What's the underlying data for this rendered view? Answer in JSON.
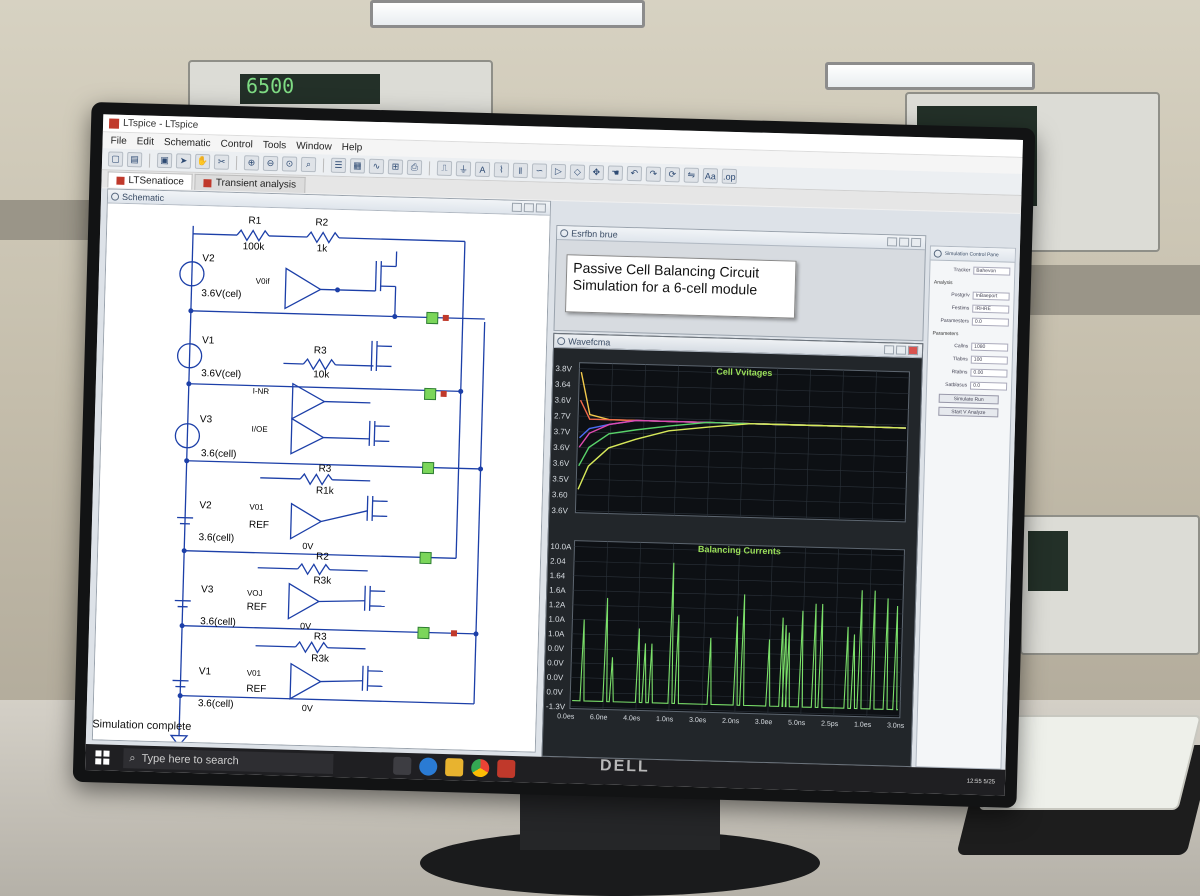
{
  "app": {
    "window_title": "LTspice - LTspice",
    "menu": [
      "File",
      "Edit",
      "Schematic",
      "Control",
      "Tools",
      "Window",
      "Help"
    ],
    "tabs": [
      {
        "label": "LTSenatioce",
        "active": true
      },
      {
        "label": "Transient analysis",
        "active": false
      }
    ]
  },
  "schematic": {
    "pane_title": "Schematic",
    "components": {
      "r1_name": "R1",
      "r1_value": "100k",
      "r2_name": "R2",
      "r2_value": "1k",
      "r3_name": "R3",
      "r3_value": "10k",
      "r3b_name": "R3",
      "r3b_value": "R1k",
      "r2b_name": "R2",
      "r2b_value": "R3k",
      "r3c_name": "R3",
      "r3c_value": "R3k",
      "cells": [
        {
          "name": "V2",
          "value": "3.6V(cel)"
        },
        {
          "name": "V1",
          "value": "3.6V(cel)"
        },
        {
          "name": "V3",
          "value": "3.6(cell)"
        },
        {
          "name": "V2",
          "value": "3.6(cell)"
        },
        {
          "name": "V3",
          "value": "3.6(cell)"
        },
        {
          "name": "V1",
          "value": "3.6(cell)"
        }
      ],
      "net_labels": [
        "V0if",
        "I-NR",
        "I/OE",
        "V01",
        "VOJ",
        "V01"
      ],
      "ref_labels": [
        "REF",
        "REF",
        "REF"
      ],
      "zero_labels": [
        "0V",
        "0V",
        "0V"
      ]
    }
  },
  "description": {
    "pane_title": "Esrfbn brue",
    "line1": "Passive Cell Balancing Circuit",
    "line2": "Simulation for a 6-cell module"
  },
  "waveform": {
    "pane_title": "Wavefcma",
    "chart_data": [
      {
        "type": "line",
        "title": "Cell Vvitages",
        "y_tick_labels": [
          "3.8V",
          "3.64",
          "3.6V",
          "2.7V",
          "3.7V",
          "3.6V",
          "3.6V",
          "3.5V",
          "3.60",
          "3.6V"
        ],
        "series": [
          {
            "color": "#f2c94c",
            "values": [
              3.8,
              3.71,
              3.7,
              3.7,
              3.7,
              3.7,
              3.7,
              3.7,
              3.7,
              3.7
            ]
          },
          {
            "color": "#f26a4b",
            "values": [
              3.74,
              3.7,
              3.7,
              3.7,
              3.7,
              3.7,
              3.7,
              3.7,
              3.7,
              3.7
            ]
          },
          {
            "color": "#4a6cf2",
            "values": [
              3.66,
              3.68,
              3.69,
              3.7,
              3.7,
              3.7,
              3.7,
              3.7,
              3.7,
              3.7
            ]
          },
          {
            "color": "#e04ab0",
            "values": [
              3.64,
              3.67,
              3.69,
              3.7,
              3.7,
              3.7,
              3.7,
              3.7,
              3.7,
              3.7
            ]
          },
          {
            "color": "#59d26a",
            "values": [
              3.6,
              3.64,
              3.67,
              3.68,
              3.69,
              3.7,
              3.7,
              3.7,
              3.7,
              3.7
            ]
          },
          {
            "color": "#d7e85a",
            "values": [
              3.55,
              3.6,
              3.64,
              3.66,
              3.68,
              3.69,
              3.7,
              3.7,
              3.7,
              3.7
            ]
          }
        ],
        "ylim": [
          3.5,
          3.82
        ]
      },
      {
        "type": "line",
        "title": "Balancing Currents",
        "y_tick_labels": [
          "10.0A",
          "2.04",
          "1.64",
          "1.6A",
          "1.2A",
          "1.0A",
          "1.0A",
          "0.0V",
          "0.0V",
          "0.0V",
          "0.0V",
          "-1.3V"
        ],
        "x_tick_labels": [
          "0.0es",
          "6.0ne",
          "4.0es",
          "1.0ns",
          "3.0es",
          "2.0ns",
          "3.0ee",
          "5.0ns",
          "2.5ps",
          "1.0es",
          "3.0ns"
        ],
        "series": [
          {
            "color": "#7be06a",
            "spikes": [
              [
                0.03,
                0.55
              ],
              [
                0.1,
                0.7
              ],
              [
                0.12,
                0.3
              ],
              [
                0.2,
                0.5
              ],
              [
                0.22,
                0.4
              ],
              [
                0.24,
                0.4
              ],
              [
                0.3,
                0.95
              ],
              [
                0.32,
                0.6
              ],
              [
                0.42,
                0.45
              ],
              [
                0.5,
                0.6
              ],
              [
                0.52,
                0.75
              ],
              [
                0.6,
                0.45
              ],
              [
                0.64,
                0.6
              ],
              [
                0.65,
                0.55
              ],
              [
                0.66,
                0.5
              ],
              [
                0.7,
                0.65
              ],
              [
                0.74,
                0.7
              ],
              [
                0.76,
                0.7
              ],
              [
                0.84,
                0.55
              ],
              [
                0.86,
                0.5
              ],
              [
                0.88,
                0.8
              ],
              [
                0.92,
                0.8
              ],
              [
                0.96,
                0.75
              ],
              [
                0.99,
                0.7
              ]
            ]
          }
        ],
        "ylim": [
          0,
          1
        ]
      }
    ]
  },
  "properties": {
    "pane_title": "Simulation Control Pane",
    "rows": [
      {
        "k": "Tracker",
        "v": "Bahevon"
      },
      {
        "k": "Postgr/v",
        "v": "InBaeport"
      },
      {
        "k": "Festims",
        "v": "IRHRE"
      },
      {
        "k": "Paramesters",
        "v": "0.0"
      },
      {
        "k": "Callns",
        "v": "1080"
      },
      {
        "k": "Tlabns",
        "v": "100"
      },
      {
        "k": "Rtabns",
        "v": "0.00"
      },
      {
        "k": "Satblasus",
        "v": "0.0"
      }
    ],
    "section_analysis": "Analysis",
    "section_params": "Parameters",
    "btn1": "Simulate Run",
    "btn2": "Start V Analyze"
  },
  "status": {
    "text": "Simulation complete"
  },
  "taskbar": {
    "search_placeholder": "Type here to search",
    "clock": "12:55 5/25"
  },
  "monitor_brand": "DELL",
  "multimeter_display": "6500"
}
